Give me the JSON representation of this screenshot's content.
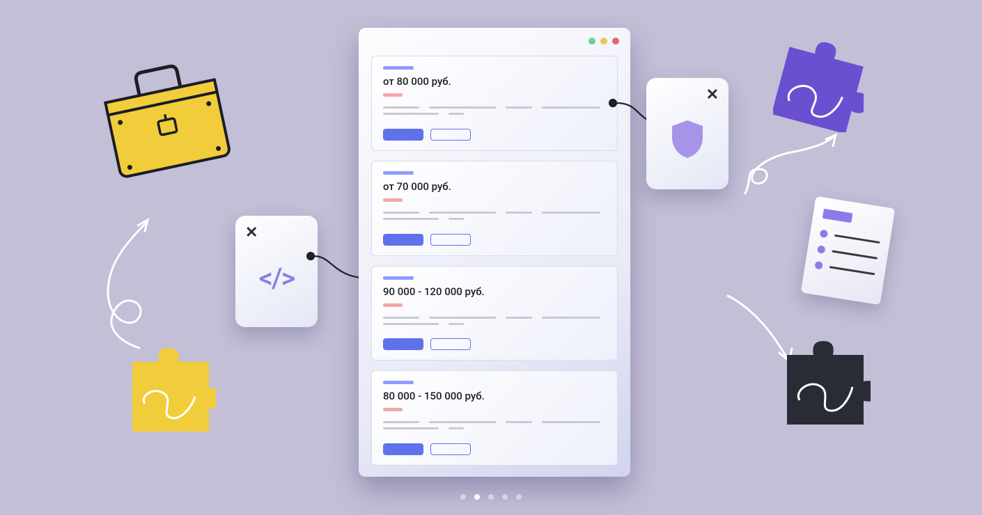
{
  "listings": [
    {
      "salary": "от 80 000 руб."
    },
    {
      "salary": "от 70 000 руб."
    },
    {
      "salary": "90 000 - 120 000 руб."
    },
    {
      "salary": "80 000 - 150 000 руб."
    }
  ],
  "popups": {
    "code_close": "✕",
    "shield_close": "✕",
    "code_glyph": "</>"
  },
  "carousel": {
    "total": 5,
    "active_index": 1
  },
  "colors": {
    "accent": "#5f71eb",
    "purple": "#8b7be7",
    "yellow": "#f2cd3b",
    "bg": "#c2bfd6"
  }
}
